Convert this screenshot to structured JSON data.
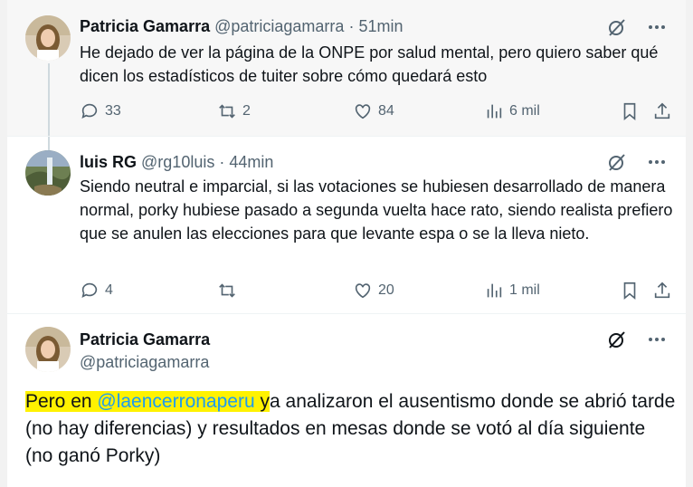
{
  "tweets": [
    {
      "name": "Patricia Gamarra",
      "handle": "@patriciagamarra",
      "separator": "·",
      "time": "51min",
      "text": "He dejado de ver la página de la ONPE por salud mental, pero quiero saber qué dicen los estadísticos de tuiter sobre cómo quedará esto",
      "replies": "33",
      "retweets": "2",
      "likes": "84",
      "views": "6 mil"
    },
    {
      "name": "luis RG",
      "handle": "@rg10luis",
      "separator": "·",
      "time": "44min",
      "text": "Siendo neutral e imparcial, si las votaciones se hubiesen desarrollado de manera normal, porky hubiese pasado a segunda vuelta hace rato, siendo realista prefiero que se anulen las elecciones para que levante espa o se la lleva nieto.",
      "replies": "4",
      "retweets": "",
      "likes": "20",
      "views": "1 mil"
    }
  ],
  "main_tweet": {
    "name": "Patricia Gamarra",
    "handle": "@patriciagamarra",
    "text_prefix": "Pero en ",
    "mention": "@laencerronaperu",
    "text_highlight_tail": " y",
    "text_rest": "a analizaron el ausentismo donde se abrió tarde (no hay diferencias) y resultados en mesas donde se votó al día siguiente (no ganó Porky)"
  },
  "colors": {
    "highlight": "#fff200",
    "mention": "#1d9bf0",
    "secondary": "#536471"
  },
  "icons": [
    "reply-icon",
    "retweet-icon",
    "like-icon",
    "views-icon",
    "bookmark-icon",
    "share-icon",
    "grok-icon",
    "more-icon"
  ]
}
